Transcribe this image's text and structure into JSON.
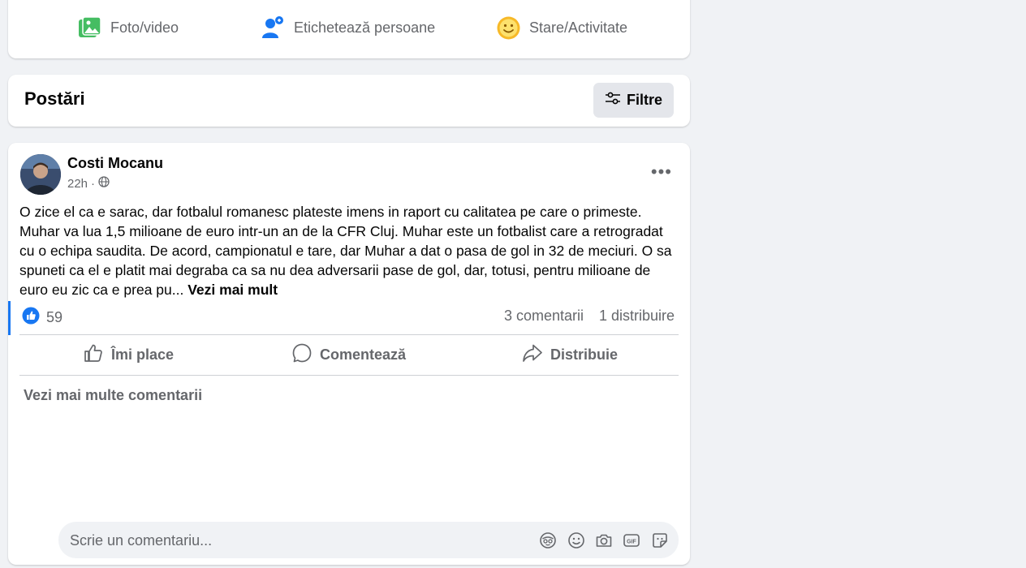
{
  "composer": {
    "photo_video": "Foto/video",
    "tag_people": "Etichetează persoane",
    "feeling_activity": "Stare/Activitate"
  },
  "posts_header": {
    "title": "Postări",
    "filter_label": "Filtre"
  },
  "post": {
    "author": "Costi Mocanu",
    "time": "22h",
    "audience_icon": "globe-icon",
    "text": "O zice el ca e sarac, dar fotbalul romanesc plateste imens in raport cu calitatea pe care o primeste. Muhar va lua 1,5 milioane de euro intr-un an de la CFR Cluj. Muhar este un fotbalist care a retrogradat cu o echipa saudita. De acord, campionatul e tare, dar Muhar a dat o pasa de gol in 32 de meciuri. O sa spuneti ca el e platit mai degraba ca sa nu dea adversarii pase de gol, dar, totusi, pentru milioane de euro eu zic ca e prea pu...",
    "see_more": "Vezi mai mult",
    "reaction_count": "59",
    "comments_count": "3 comentarii",
    "shares_count": "1 distribuire",
    "actions": {
      "like": "Îmi place",
      "comment": "Comentează",
      "share": "Distribuie"
    },
    "view_more_comments": "Vezi mai multe comentarii",
    "comment_placeholder": "Scrie un comentariu..."
  },
  "colors": {
    "accent": "#1877f2",
    "background": "#f0f2f5",
    "secondary_text": "#65676b"
  }
}
